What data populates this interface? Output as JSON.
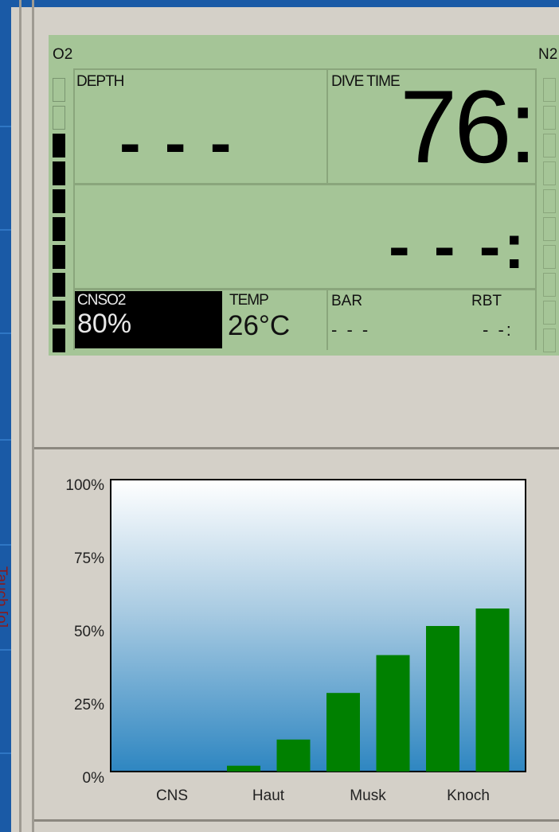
{
  "window": {
    "side_label": "Tauch [o]"
  },
  "dive_computer": {
    "o2_label": "O2",
    "n2_label": "N2",
    "depth_label": "DEPTH",
    "depth_value": "- - -",
    "dive_time_label": "DIVE TIME",
    "dive_time_value": "76:",
    "deco_value": "- - -:",
    "cnso2_label": "CNSO2",
    "cnso2_value": "80%",
    "temp_label": "TEMP",
    "temp_value": "26°C",
    "bar_label": "BAR",
    "bar_value": "- - -",
    "rbt_label": "RBT",
    "rbt_value": "- -:",
    "o2_bar_lit_segments": 8,
    "o2_bar_total_segments": 10,
    "colors": {
      "lcd": "#a5c597",
      "segment_on": "#000000"
    }
  },
  "chart_data": {
    "type": "bar",
    "categories": [
      "CNS",
      "",
      "Haut",
      "",
      "Musk",
      "",
      "Knoch",
      ""
    ],
    "values": [
      0,
      0,
      2,
      11,
      27,
      40,
      50,
      56
    ],
    "ytick_labels": [
      "100%",
      "75%",
      "50%",
      "25%",
      "0%"
    ],
    "xtick_labels": [
      "CNS",
      "Haut",
      "Musk",
      "Knoch"
    ],
    "ylim": [
      0,
      100
    ],
    "bar_color": "#008000",
    "background": "vertical gradient white to blue"
  }
}
